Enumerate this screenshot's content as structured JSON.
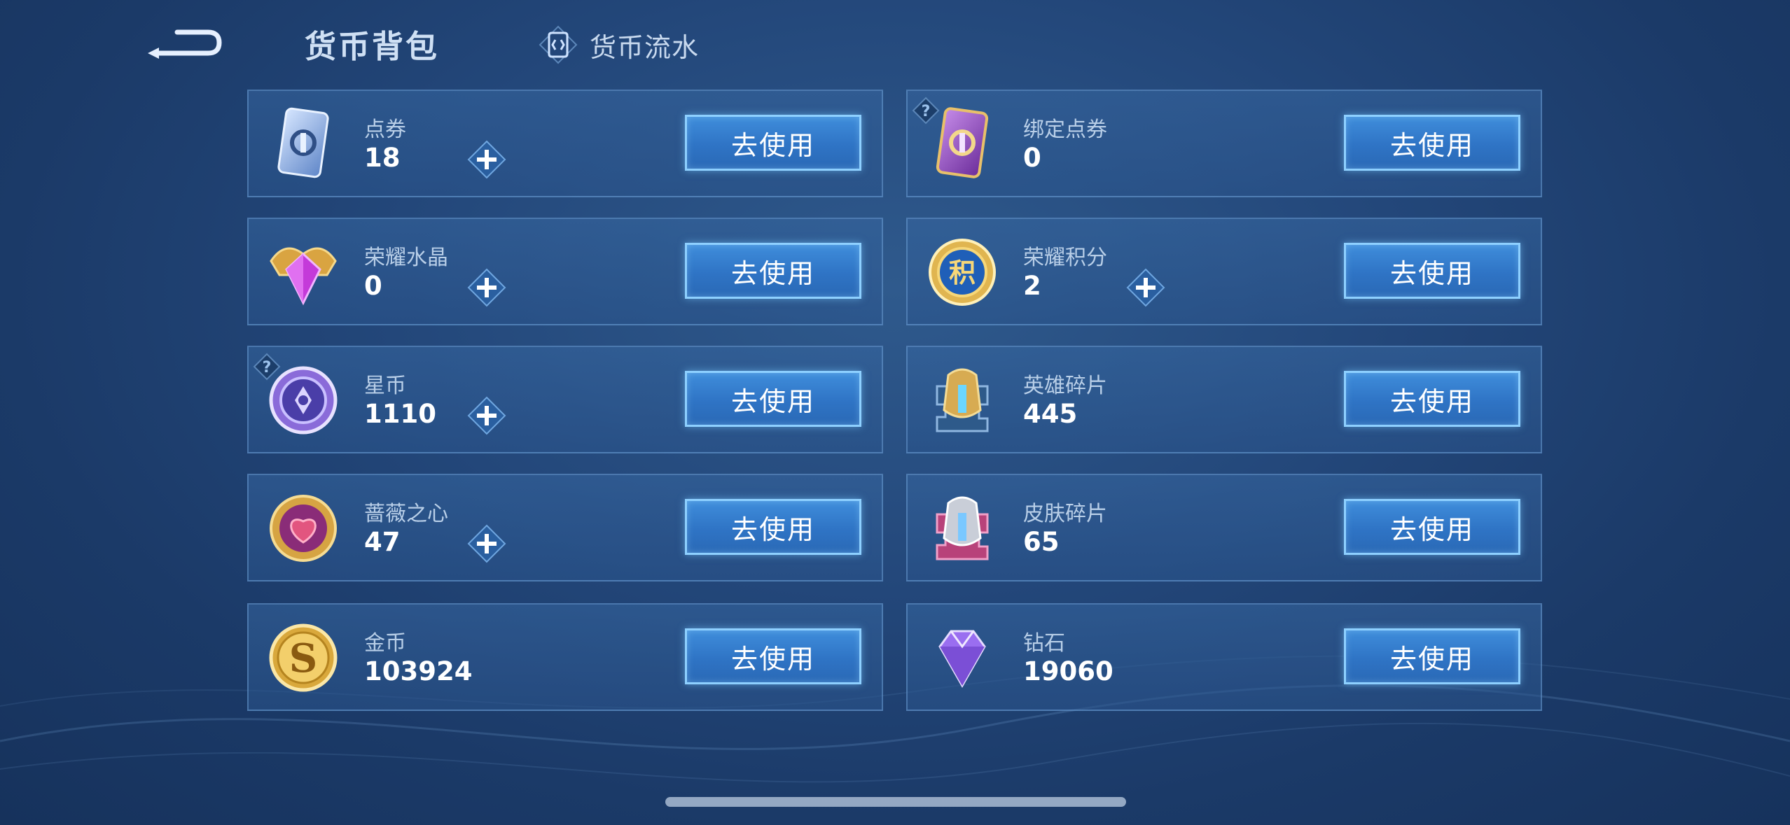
{
  "header": {
    "title": "货币背包",
    "flow_tab_label": "货币流水"
  },
  "currencies": [
    {
      "name": "点券",
      "value": "18",
      "button": "去使用",
      "icon": "voucher-icon",
      "has_plus": true,
      "has_help": false
    },
    {
      "name": "绑定点券",
      "value": "0",
      "button": "去使用",
      "icon": "bound-voucher-icon",
      "has_plus": false,
      "has_help": true
    },
    {
      "name": "荣耀水晶",
      "value": "0",
      "button": "去使用",
      "icon": "glory-crystal-icon",
      "has_plus": true,
      "has_help": false
    },
    {
      "name": "荣耀积分",
      "value": "2",
      "button": "去使用",
      "icon": "glory-points-icon",
      "has_plus": true,
      "has_help": false
    },
    {
      "name": "星币",
      "value": "1110",
      "button": "去使用",
      "icon": "star-coin-icon",
      "has_plus": true,
      "has_help": true
    },
    {
      "name": "英雄碎片",
      "value": "445",
      "button": "去使用",
      "icon": "hero-fragment-icon",
      "has_plus": false,
      "has_help": false
    },
    {
      "name": "蔷薇之心",
      "value": "47",
      "button": "去使用",
      "icon": "rose-heart-icon",
      "has_plus": true,
      "has_help": false
    },
    {
      "name": "皮肤碎片",
      "value": "65",
      "button": "去使用",
      "icon": "skin-fragment-icon",
      "has_plus": false,
      "has_help": false
    },
    {
      "name": "金币",
      "value": "103924",
      "button": "去使用",
      "icon": "gold-coin-icon",
      "has_plus": false,
      "has_help": false
    },
    {
      "name": "钻石",
      "value": "19060",
      "button": "去使用",
      "icon": "diamond-icon",
      "has_plus": false,
      "has_help": false
    }
  ],
  "colors": {
    "background": "#23477a",
    "button": "#2f74c5",
    "button_border": "#8ed0ff",
    "value_text": "#ffffff",
    "label_text": "#b9cfe8"
  }
}
